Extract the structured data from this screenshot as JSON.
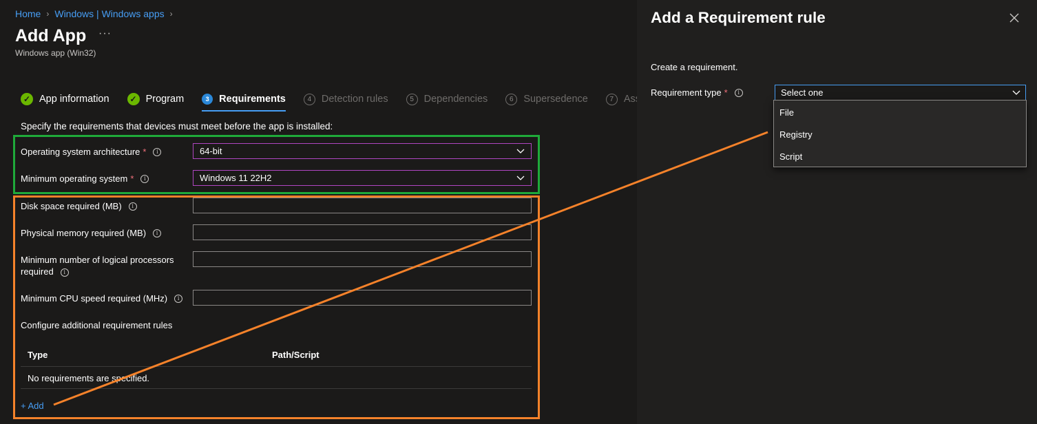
{
  "breadcrumb": {
    "home": "Home",
    "section": "Windows | Windows apps",
    "separator": ">"
  },
  "header": {
    "title": "Add App",
    "more": "···",
    "subtitle": "Windows app (Win32)"
  },
  "tabs": [
    {
      "num": "✓",
      "label": "App information",
      "state": "done"
    },
    {
      "num": "✓",
      "label": "Program",
      "state": "done"
    },
    {
      "num": "3",
      "label": "Requirements",
      "state": "active"
    },
    {
      "num": "4",
      "label": "Detection rules",
      "state": "pending"
    },
    {
      "num": "5",
      "label": "Dependencies",
      "state": "pending"
    },
    {
      "num": "6",
      "label": "Supersedence",
      "state": "pending"
    },
    {
      "num": "7",
      "label": "Assign",
      "state": "pending"
    }
  ],
  "requirements": {
    "intro": "Specify the requirements that devices must meet before the app is installed:",
    "os_arch": {
      "label": "Operating system architecture",
      "required": "*",
      "value": "64-bit"
    },
    "min_os": {
      "label": "Minimum operating system",
      "required": "*",
      "value": "Windows 11 22H2"
    },
    "disk": {
      "label": "Disk space required (MB)",
      "value": ""
    },
    "memory": {
      "label": "Physical memory required (MB)",
      "value": ""
    },
    "processors": {
      "label": "Minimum number of logical processors required",
      "value": ""
    },
    "cpu": {
      "label": "Minimum CPU speed required (MHz)",
      "value": ""
    },
    "additional_label": "Configure additional requirement rules",
    "table": {
      "col_type": "Type",
      "col_path": "Path/Script",
      "empty": "No requirements are specified."
    },
    "add_link": "+ Add"
  },
  "panel": {
    "title": "Add a Requirement rule",
    "create": "Create a requirement.",
    "type_label": "Requirement type",
    "required": "*",
    "select_value": "Select one",
    "options": [
      "File",
      "Registry",
      "Script"
    ]
  },
  "info_glyph": "i",
  "colors": {
    "accent": "#479ef5",
    "green_box": "#1faa3a",
    "orange_box": "#f5822a",
    "select_border": "#b146c2",
    "required": "#f1707b"
  }
}
